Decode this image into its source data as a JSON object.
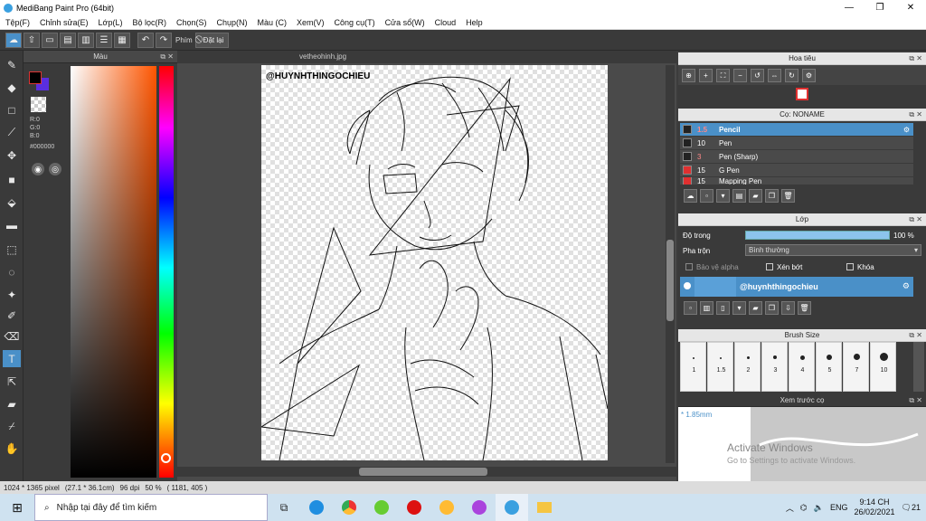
{
  "window": {
    "title": "MediBang Paint Pro (64bit)",
    "minimize": "—",
    "restore": "❐",
    "close": "✕"
  },
  "menu": [
    "Tệp(F)",
    "Chỉnh sửa(E)",
    "Lớp(L)",
    "Bộ lọc(R)",
    "Chọn(S)",
    "Chụp(N)",
    "Màu (C)",
    "Xem(V)",
    "Công cụ(T)",
    "Cửa sổ(W)",
    "Cloud",
    "Help"
  ],
  "toolbar": {
    "key_label": "Phím",
    "reset_label": "Đặt lại"
  },
  "color_panel": {
    "title": "Màu",
    "r": "R:0",
    "g": "G:0",
    "b": "B:0",
    "hex": "#000000",
    "fg_color": "#000000",
    "bg_color": "#5a2ee0"
  },
  "document": {
    "tab": "vetheohinh.jpg",
    "watermark": "@HUYNHTHINGOCHIEU"
  },
  "status": {
    "size": "1024 * 1365 pixel",
    "cm": "(27.1 * 36.1cm)",
    "dpi": "96 dpi",
    "zoom": "50 %",
    "coord": "( 1181, 405 )"
  },
  "navigator": {
    "title": "Hoa tiêu"
  },
  "brush_panel": {
    "title": "Cọ: NONAME",
    "items": [
      {
        "size": "1.5",
        "name": "Pencil",
        "color": "#222222",
        "selected": true
      },
      {
        "size": "10",
        "name": "Pen",
        "color": "#222222",
        "selected": false
      },
      {
        "size": "3",
        "name": "Pen (Sharp)",
        "color": "#222222",
        "selected": false
      },
      {
        "size": "15",
        "name": "G Pen",
        "color": "#e03030",
        "selected": false
      },
      {
        "size": "15",
        "name": "Mapping Pen",
        "color": "#e03030",
        "selected": false
      }
    ]
  },
  "layer_panel": {
    "title": "Lớp",
    "opacity_label": "Độ trong",
    "opacity_value": "100 %",
    "blend_label": "Pha trộn",
    "blend_value": "Bình thường",
    "protect_alpha": "Bảo vệ alpha",
    "clipping": "Xén bớt",
    "lock": "Khóa",
    "layer_name": "@huynhthingochieu"
  },
  "brush_size_panel": {
    "title": "Brush Size",
    "sizes": [
      "1",
      "1.5",
      "2",
      "3",
      "4",
      "5",
      "7",
      "10"
    ]
  },
  "preview_panel": {
    "title": "Xem trước cọ",
    "size": "* 1.85mm",
    "activate_title": "Activate Windows",
    "activate_sub": "Go to Settings to activate Windows."
  },
  "taskbar": {
    "search_placeholder": "Nhập tại đây để tìm kiếm",
    "lang": "ENG",
    "time": "9:14 CH",
    "date": "26/02/2021",
    "notif": "21"
  }
}
